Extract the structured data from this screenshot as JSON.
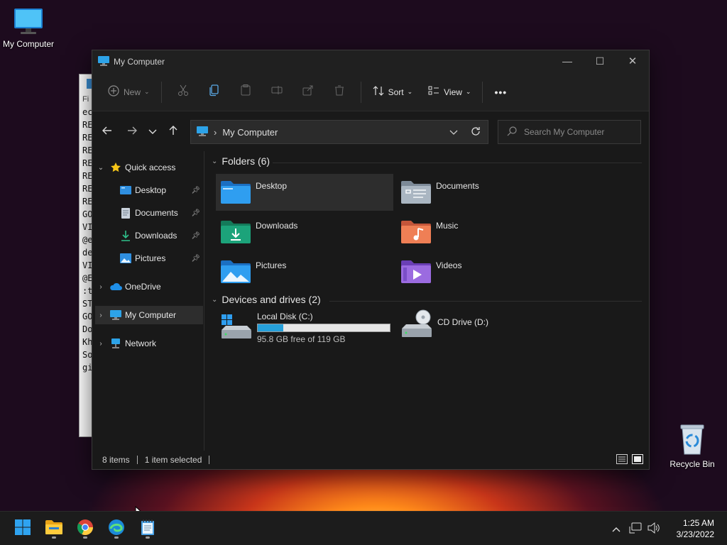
{
  "desktop": {
    "icons": [
      {
        "label": "My Computer"
      },
      {
        "label": "Recycle Bin"
      }
    ]
  },
  "notepad": {
    "menu_fragment": "Fi",
    "lines": [
      "ec",
      "RE",
      "RE",
      "RE",
      "RE",
      "RE",
      "RE",
      "RE",
      "GO",
      "VI",
      "@e",
      "de",
      "VI",
      "@E",
      ":t",
      "ST",
      "GO",
      "Do",
      "Kh",
      "So",
      "gi"
    ]
  },
  "window": {
    "title": "My Computer",
    "controls": {
      "minimize": "—",
      "maximize": "☐",
      "close": "✕"
    }
  },
  "toolbar": {
    "new_label": "New",
    "sort_label": "Sort",
    "view_label": "View",
    "more_label": "•••"
  },
  "address": {
    "path": "My Computer",
    "search_placeholder": "Search My Computer"
  },
  "sidebar": {
    "quick_access": "Quick access",
    "items": [
      {
        "label": "Desktop"
      },
      {
        "label": "Documents"
      },
      {
        "label": "Downloads"
      },
      {
        "label": "Pictures"
      }
    ],
    "onedrive": "OneDrive",
    "my_computer": "My Computer",
    "network": "Network"
  },
  "content": {
    "folders_header": "Folders (6)",
    "folders": [
      {
        "name": "Desktop"
      },
      {
        "name": "Documents"
      },
      {
        "name": "Downloads"
      },
      {
        "name": "Music"
      },
      {
        "name": "Pictures"
      },
      {
        "name": "Videos"
      }
    ],
    "drives_header": "Devices and drives (2)",
    "drives": [
      {
        "name": "Local Disk (C:)",
        "free": "95.8 GB free of 119 GB",
        "used_fraction": 0.195
      },
      {
        "name": "CD Drive (D:)"
      }
    ]
  },
  "status": {
    "items": "8 items",
    "selected": "1 item selected"
  },
  "taskbar": {
    "apps": [
      "start-icon",
      "file-explorer-icon",
      "chrome-icon",
      "edge-icon",
      "notepad-icon"
    ],
    "time": "1:25 AM",
    "date": "3/23/2022"
  },
  "colors": {
    "accent": "#26a0da",
    "window_bg": "#191919",
    "folder_blue": "#2f8fe0",
    "folder_green": "#1ca37a"
  }
}
